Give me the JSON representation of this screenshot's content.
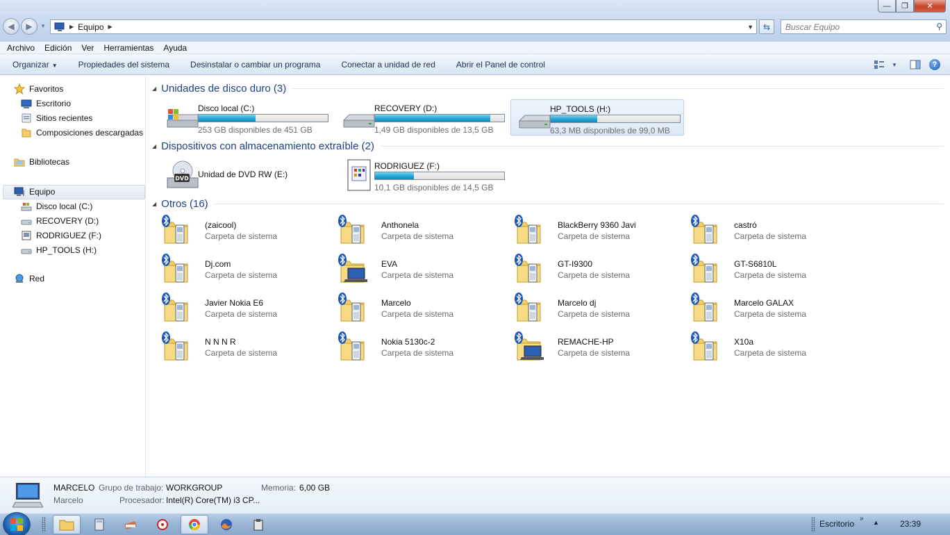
{
  "window": {
    "address_crumb": "Equipo",
    "search_placeholder": "Buscar Equipo"
  },
  "menu": [
    "Archivo",
    "Edición",
    "Ver",
    "Herramientas",
    "Ayuda"
  ],
  "commands": {
    "organize": "Organizar",
    "system_properties": "Propiedades del sistema",
    "uninstall": "Desinstalar o cambiar un programa",
    "map_drive": "Conectar a unidad de red",
    "control_panel": "Abrir el Panel de control"
  },
  "nav": {
    "favorites": "Favoritos",
    "desktop": "Escritorio",
    "recent": "Sitios recientes",
    "downloads": "Composiciones descargadas",
    "libraries": "Bibliotecas",
    "computer": "Equipo",
    "drive_c": "Disco local (C:)",
    "drive_d": "RECOVERY (D:)",
    "drive_f": "RODRIGUEZ (F:)",
    "drive_h": "HP_TOOLS (H:)",
    "network": "Red"
  },
  "groups": {
    "hard_drives": "Unidades de disco duro (3)",
    "removable": "Dispositivos con almacenamiento extraíble (2)",
    "others": "Otros (16)"
  },
  "hard_drives": [
    {
      "name": "Disco local (C:)",
      "free": "253 GB disponibles de 451 GB",
      "used_fraction": 0.44
    },
    {
      "name": "RECOVERY (D:)",
      "free": "1,49 GB disponibles de 13,5 GB",
      "used_fraction": 0.89
    },
    {
      "name": "HP_TOOLS (H:)",
      "free": "63,3 MB disponibles de 99,0 MB",
      "used_fraction": 0.36
    }
  ],
  "removable": [
    {
      "name": "Unidad de DVD RW (E:)"
    },
    {
      "name": "RODRIGUEZ (F:)",
      "free": "10,1 GB disponibles de 14,5 GB",
      "used_fraction": 0.3
    }
  ],
  "others_subtitle": "Carpeta de sistema",
  "others": [
    "(zaicool)",
    "Anthonela",
    "BlackBerry 9360 Javi",
    "castró",
    "Dj.com",
    "EVA",
    "GT-I9300",
    "GT-S6810L",
    "Javier Nokia E6",
    "Marcelo",
    "Marcelo dj",
    "Marcelo GALAX",
    "N N N R",
    "Nokia 5130c-2",
    "REMACHE-HP",
    "X10a"
  ],
  "details": {
    "computer_name": "MARCELO",
    "user": "Marcelo",
    "workgroup_label": "Grupo de trabajo:",
    "workgroup": "WORKGROUP",
    "memory_label": "Memoria:",
    "memory": "6,00 GB",
    "cpu_label": "Procesador:",
    "cpu": "Intel(R) Core(TM) i3 CP..."
  },
  "taskbar": {
    "desktop_toolbar": "Escritorio",
    "clock": "23:39"
  },
  "colors": {
    "bar_fill": "#26a6d6",
    "group_header": "#1e3f8a",
    "secondary_text": "#6d6d6d"
  }
}
